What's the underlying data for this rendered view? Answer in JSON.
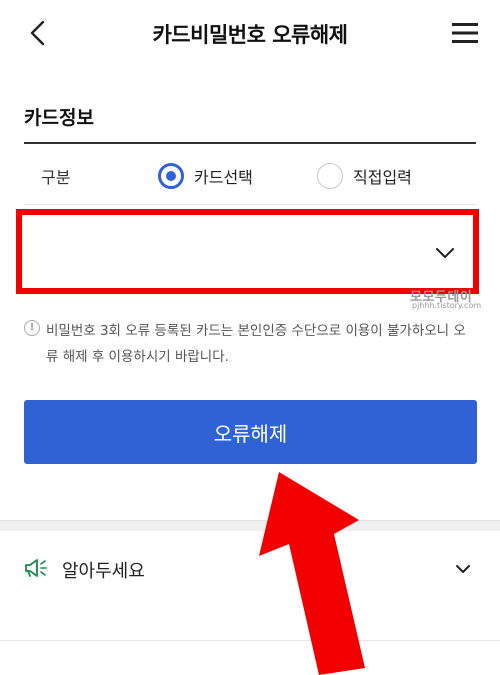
{
  "header": {
    "title": "카드비밀번호 오류해제",
    "back_icon": "chevron-left-icon",
    "menu_icon": "hamburger-menu-icon"
  },
  "card_info": {
    "section_title": "카드정보",
    "type_label": "구분",
    "radio_options": [
      {
        "label": "카드선택",
        "selected": true
      },
      {
        "label": "직접입력",
        "selected": false
      }
    ],
    "card_select_value": "",
    "card_select_highlight_color": "#f20000"
  },
  "watermark": {
    "main": "모모두데이",
    "sub": "pjhhh.tistory.com"
  },
  "notice": {
    "icon": "exclamation-circle-icon",
    "text": "비밀번호 3회 오류 등록된 카드는 본인인증 수단으로 이용이 불가하오니 오류 해제 후 이용하시기 바랍니다."
  },
  "primary_button": {
    "label": "오류해제",
    "color": "#2f63d5"
  },
  "guide": {
    "label": "알아두세요",
    "icon": "megaphone-icon",
    "toggle_icon": "chevron-down-icon"
  },
  "annotation": {
    "arrow_color": "#f20000",
    "arrow_icon": "red-up-arrow-icon"
  }
}
